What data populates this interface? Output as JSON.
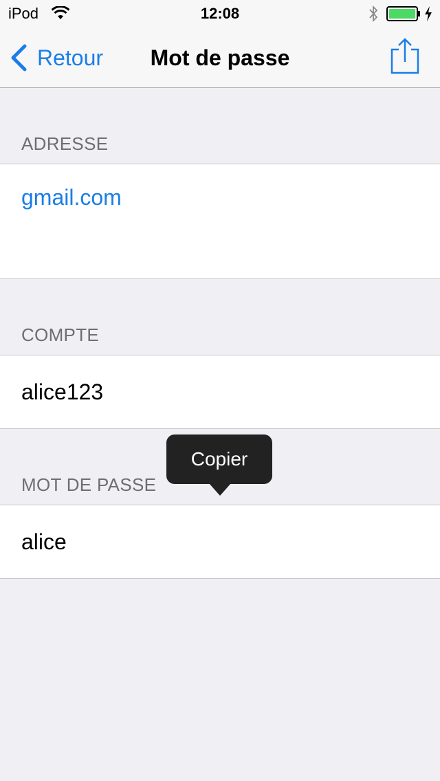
{
  "status_bar": {
    "device": "iPod",
    "time": "12:08",
    "battery_color": "#4cd964"
  },
  "nav": {
    "back_label": "Retour",
    "title": "Mot de passe",
    "accent_color": "#1a7ee6"
  },
  "sections": {
    "address": {
      "header": "ADRESSE",
      "value": "gmail.com"
    },
    "account": {
      "header": "COMPTE",
      "value": "alice123"
    },
    "password": {
      "header": "MOT DE PASSE",
      "value": "alice"
    }
  },
  "tooltip": {
    "label": "Copier"
  }
}
